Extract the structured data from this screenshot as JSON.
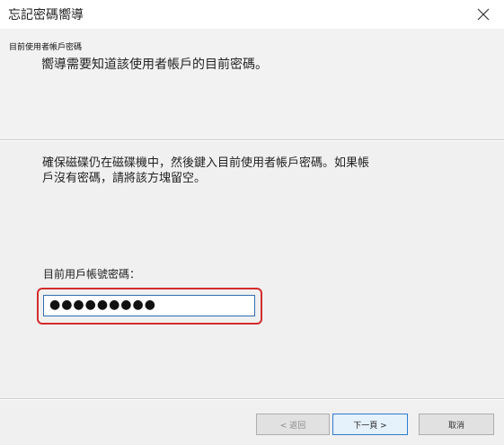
{
  "window": {
    "title": "忘記密碼嚮導",
    "close_icon": "close-icon"
  },
  "header": {
    "title": "目前使用者帳戶密碼",
    "subtitle": "嚮導需要知道該使用者帳戶的目前密碼。"
  },
  "main": {
    "instructions": "確保磁碟仍在磁碟機中，然後鍵入目前使用者帳戶密碼。如果帳戶沒有密碼，請將該方塊留空。",
    "password_label": "目前用戶帳號密碼：",
    "password_value": "●●●●●●●●●"
  },
  "buttons": {
    "back": "< 返回",
    "next": "下一頁 >",
    "cancel": "取消"
  },
  "colors": {
    "highlight": "#d42c2c",
    "input_border": "#2f6fb2",
    "default_button_border": "#2f7ccf"
  }
}
